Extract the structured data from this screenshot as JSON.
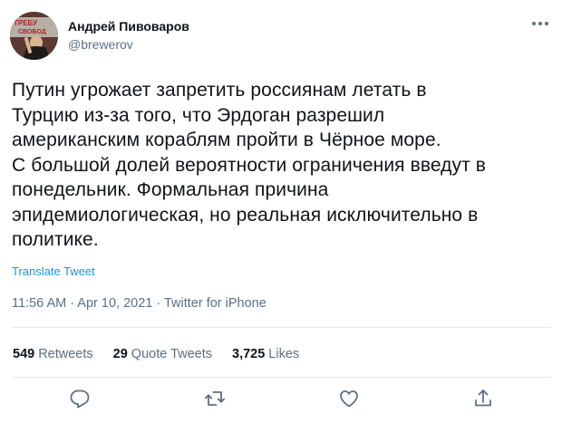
{
  "author": {
    "name": "Андрей Пивоваров",
    "handle": "@brewerov",
    "avatar_text": "ТРЕБУЕМ СВОБОД"
  },
  "tweet": {
    "text": "Путин угрожает запретить россиянам летать в\nТурцию из-за того, что Эрдоган разрешил\nамериканским кораблям пройти в Чёрное море.\nС большой долей вероятности ограничения введут в\nпонедельник. Формальная причина\nэпидемиологическая, но реальная исключительно в\nполитике.",
    "translate_label": "Translate Tweet"
  },
  "meta": {
    "time": "11:56 AM",
    "separator": " · ",
    "date": "Apr 10, 2021",
    "source": "Twitter for iPhone"
  },
  "stats": {
    "retweets": {
      "count": "549",
      "label": "Retweets"
    },
    "quotes": {
      "count": "29",
      "label": "Quote Tweets"
    },
    "likes": {
      "count": "3,725",
      "label": "Likes"
    }
  },
  "icons": {
    "more": "more-horizontal-icon",
    "reply": "reply-icon",
    "retweet": "retweet-icon",
    "like": "heart-icon",
    "share": "share-icon"
  },
  "colors": {
    "text": "#0f1419",
    "secondary": "#5b7083",
    "link": "#1b95e0",
    "divider": "#e1e8ed"
  }
}
